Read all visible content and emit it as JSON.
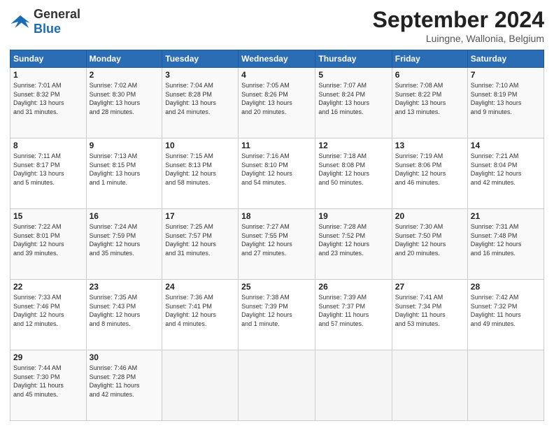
{
  "logo": {
    "text_general": "General",
    "text_blue": "Blue"
  },
  "header": {
    "month_title": "September 2024",
    "subtitle": "Luingne, Wallonia, Belgium"
  },
  "weekdays": [
    "Sunday",
    "Monday",
    "Tuesday",
    "Wednesday",
    "Thursday",
    "Friday",
    "Saturday"
  ],
  "weeks": [
    [
      {
        "day": "1",
        "info": "Sunrise: 7:01 AM\nSunset: 8:32 PM\nDaylight: 13 hours\nand 31 minutes."
      },
      {
        "day": "2",
        "info": "Sunrise: 7:02 AM\nSunset: 8:30 PM\nDaylight: 13 hours\nand 28 minutes."
      },
      {
        "day": "3",
        "info": "Sunrise: 7:04 AM\nSunset: 8:28 PM\nDaylight: 13 hours\nand 24 minutes."
      },
      {
        "day": "4",
        "info": "Sunrise: 7:05 AM\nSunset: 8:26 PM\nDaylight: 13 hours\nand 20 minutes."
      },
      {
        "day": "5",
        "info": "Sunrise: 7:07 AM\nSunset: 8:24 PM\nDaylight: 13 hours\nand 16 minutes."
      },
      {
        "day": "6",
        "info": "Sunrise: 7:08 AM\nSunset: 8:22 PM\nDaylight: 13 hours\nand 13 minutes."
      },
      {
        "day": "7",
        "info": "Sunrise: 7:10 AM\nSunset: 8:19 PM\nDaylight: 13 hours\nand 9 minutes."
      }
    ],
    [
      {
        "day": "8",
        "info": "Sunrise: 7:11 AM\nSunset: 8:17 PM\nDaylight: 13 hours\nand 5 minutes."
      },
      {
        "day": "9",
        "info": "Sunrise: 7:13 AM\nSunset: 8:15 PM\nDaylight: 13 hours\nand 1 minute."
      },
      {
        "day": "10",
        "info": "Sunrise: 7:15 AM\nSunset: 8:13 PM\nDaylight: 12 hours\nand 58 minutes."
      },
      {
        "day": "11",
        "info": "Sunrise: 7:16 AM\nSunset: 8:10 PM\nDaylight: 12 hours\nand 54 minutes."
      },
      {
        "day": "12",
        "info": "Sunrise: 7:18 AM\nSunset: 8:08 PM\nDaylight: 12 hours\nand 50 minutes."
      },
      {
        "day": "13",
        "info": "Sunrise: 7:19 AM\nSunset: 8:06 PM\nDaylight: 12 hours\nand 46 minutes."
      },
      {
        "day": "14",
        "info": "Sunrise: 7:21 AM\nSunset: 8:04 PM\nDaylight: 12 hours\nand 42 minutes."
      }
    ],
    [
      {
        "day": "15",
        "info": "Sunrise: 7:22 AM\nSunset: 8:01 PM\nDaylight: 12 hours\nand 39 minutes."
      },
      {
        "day": "16",
        "info": "Sunrise: 7:24 AM\nSunset: 7:59 PM\nDaylight: 12 hours\nand 35 minutes."
      },
      {
        "day": "17",
        "info": "Sunrise: 7:25 AM\nSunset: 7:57 PM\nDaylight: 12 hours\nand 31 minutes."
      },
      {
        "day": "18",
        "info": "Sunrise: 7:27 AM\nSunset: 7:55 PM\nDaylight: 12 hours\nand 27 minutes."
      },
      {
        "day": "19",
        "info": "Sunrise: 7:28 AM\nSunset: 7:52 PM\nDaylight: 12 hours\nand 23 minutes."
      },
      {
        "day": "20",
        "info": "Sunrise: 7:30 AM\nSunset: 7:50 PM\nDaylight: 12 hours\nand 20 minutes."
      },
      {
        "day": "21",
        "info": "Sunrise: 7:31 AM\nSunset: 7:48 PM\nDaylight: 12 hours\nand 16 minutes."
      }
    ],
    [
      {
        "day": "22",
        "info": "Sunrise: 7:33 AM\nSunset: 7:46 PM\nDaylight: 12 hours\nand 12 minutes."
      },
      {
        "day": "23",
        "info": "Sunrise: 7:35 AM\nSunset: 7:43 PM\nDaylight: 12 hours\nand 8 minutes."
      },
      {
        "day": "24",
        "info": "Sunrise: 7:36 AM\nSunset: 7:41 PM\nDaylight: 12 hours\nand 4 minutes."
      },
      {
        "day": "25",
        "info": "Sunrise: 7:38 AM\nSunset: 7:39 PM\nDaylight: 12 hours\nand 1 minute."
      },
      {
        "day": "26",
        "info": "Sunrise: 7:39 AM\nSunset: 7:37 PM\nDaylight: 11 hours\nand 57 minutes."
      },
      {
        "day": "27",
        "info": "Sunrise: 7:41 AM\nSunset: 7:34 PM\nDaylight: 11 hours\nand 53 minutes."
      },
      {
        "day": "28",
        "info": "Sunrise: 7:42 AM\nSunset: 7:32 PM\nDaylight: 11 hours\nand 49 minutes."
      }
    ],
    [
      {
        "day": "29",
        "info": "Sunrise: 7:44 AM\nSunset: 7:30 PM\nDaylight: 11 hours\nand 45 minutes."
      },
      {
        "day": "30",
        "info": "Sunrise: 7:46 AM\nSunset: 7:28 PM\nDaylight: 11 hours\nand 42 minutes."
      },
      {
        "day": "",
        "info": ""
      },
      {
        "day": "",
        "info": ""
      },
      {
        "day": "",
        "info": ""
      },
      {
        "day": "",
        "info": ""
      },
      {
        "day": "",
        "info": ""
      }
    ]
  ]
}
